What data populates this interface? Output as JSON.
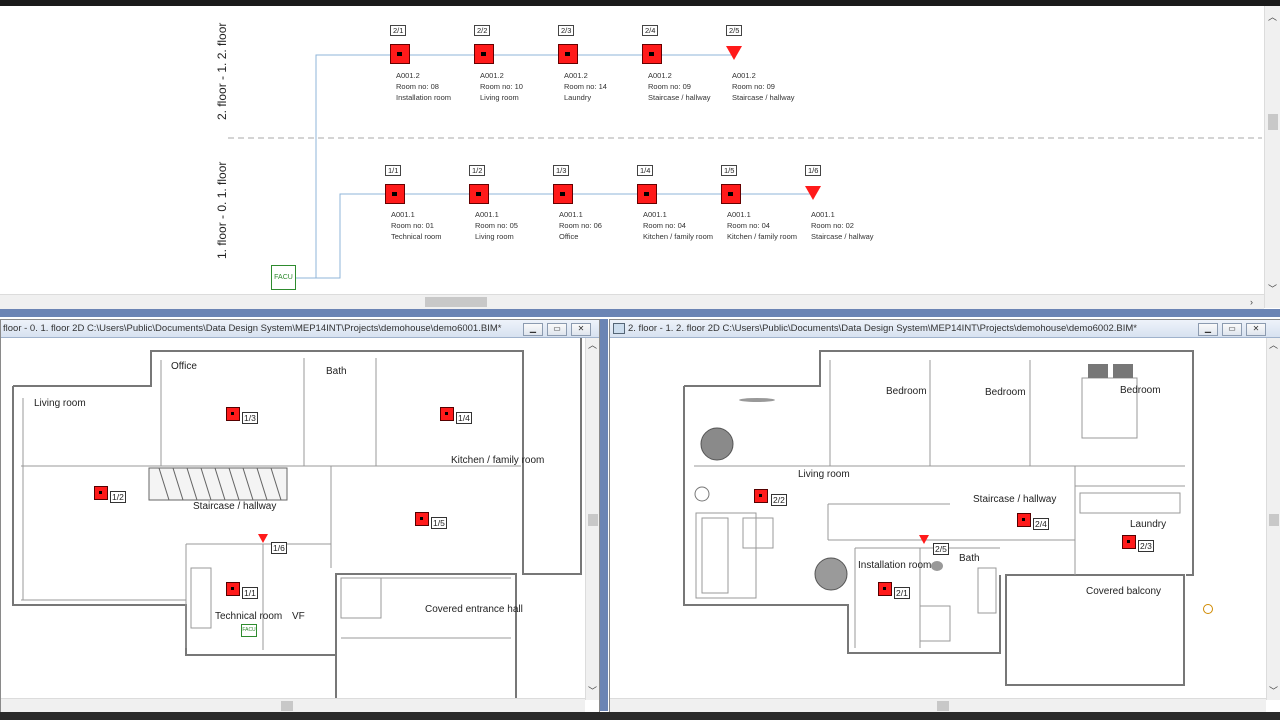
{
  "schematic": {
    "floor2_label": "2. floor - 1. 2. floor",
    "floor1_label": "1. floor - 0. 1. floor",
    "facu_label": "FACU",
    "floor2_devices": [
      {
        "tag": "2/1",
        "sheet": "A001.2",
        "room": "Room no: 08",
        "name": "Installation room",
        "type": "detector"
      },
      {
        "tag": "2/2",
        "sheet": "A001.2",
        "room": "Room no: 10",
        "name": "Living room",
        "type": "detector"
      },
      {
        "tag": "2/3",
        "sheet": "A001.2",
        "room": "Room no: 14",
        "name": "Laundry",
        "type": "detector"
      },
      {
        "tag": "2/4",
        "sheet": "A001.2",
        "room": "Room no: 09",
        "name": "Staircase / hallway",
        "type": "detector"
      },
      {
        "tag": "2/5",
        "sheet": "A001.2",
        "room": "Room no: 09",
        "name": "Staircase / hallway",
        "type": "sounder"
      }
    ],
    "floor1_devices": [
      {
        "tag": "1/1",
        "sheet": "A001.1",
        "room": "Room no: 01",
        "name": "Technical room",
        "type": "detector"
      },
      {
        "tag": "1/2",
        "sheet": "A001.1",
        "room": "Room no: 05",
        "name": "Living room",
        "type": "detector"
      },
      {
        "tag": "1/3",
        "sheet": "A001.1",
        "room": "Room no: 06",
        "name": "Office",
        "type": "detector"
      },
      {
        "tag": "1/4",
        "sheet": "A001.1",
        "room": "Room no: 04",
        "name": "Kitchen / family room",
        "type": "detector"
      },
      {
        "tag": "1/5",
        "sheet": "A001.1",
        "room": "Room no: 04",
        "name": "Kitchen / family room",
        "type": "detector"
      },
      {
        "tag": "1/6",
        "sheet": "A001.1",
        "room": "Room no: 02",
        "name": "Staircase / hallway",
        "type": "sounder"
      }
    ]
  },
  "left_window": {
    "title": "floor - 0. 1. floor  2D  C:\\Users\\Public\\Documents\\Data Design System\\MEP14INT\\Projects\\demohouse\\demo6001.BIM*",
    "rooms": {
      "office": "Office",
      "bath": "Bath",
      "living": "Living room",
      "kitchen": "Kitchen / family room",
      "staircase": "Staircase / hallway",
      "technical": "Technical room",
      "vf": "VF",
      "entrance": "Covered entrance hall"
    },
    "tags": {
      "t13": "1/3",
      "t14": "1/4",
      "t12": "1/2",
      "t15": "1/5",
      "t16": "1/6",
      "t11": "1/1"
    },
    "facu_small": "FACU"
  },
  "right_window": {
    "title": "2. floor - 1. 2. floor  2D  C:\\Users\\Public\\Documents\\Data Design System\\MEP14INT\\Projects\\demohouse\\demo6002.BIM*",
    "rooms": {
      "bedroom1": "Bedroom",
      "bedroom2": "Bedroom",
      "bedroom3": "Bedroom",
      "living": "Living room",
      "staircase": "Staircase / hallway",
      "laundry": "Laundry",
      "installation": "Installation room",
      "bath": "Bath",
      "balcony": "Covered balcony"
    },
    "tags": {
      "t22": "2/2",
      "t24": "2/4",
      "t23": "2/3",
      "t25": "2/5",
      "t21": "2/1"
    }
  },
  "colors": {
    "detector": "#ff1a1a",
    "wire": "#8fb4d8",
    "facu": "#2e8b2e"
  }
}
